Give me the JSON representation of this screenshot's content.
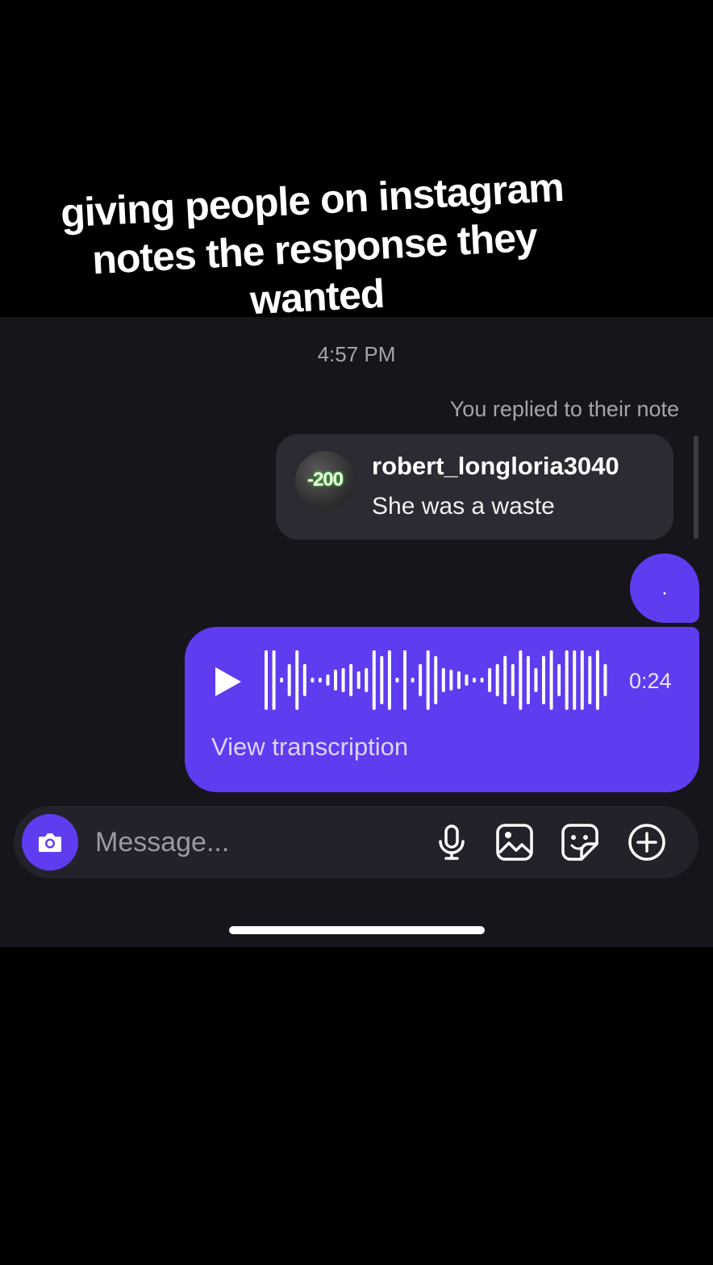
{
  "overlay": {
    "caption_lines": [
      "giving people on instagram",
      "notes the response they",
      "wanted"
    ]
  },
  "chat": {
    "timestamp": "4:57 PM",
    "reply_label": "You replied to their note",
    "note": {
      "avatar_text": "-200",
      "username": "robert_longloria3040",
      "text": "She was a waste"
    },
    "dot_message": ".",
    "voice_message": {
      "duration": "0:24",
      "transcription_link": "View transcription"
    }
  },
  "composer": {
    "placeholder": "Message...",
    "icons": [
      "camera-icon",
      "microphone-icon",
      "gallery-icon",
      "sticker-icon",
      "plus-icon"
    ]
  },
  "colors": {
    "accent": "#5f3cf0",
    "background": "#15151b",
    "note_card": "#2b2b33"
  }
}
